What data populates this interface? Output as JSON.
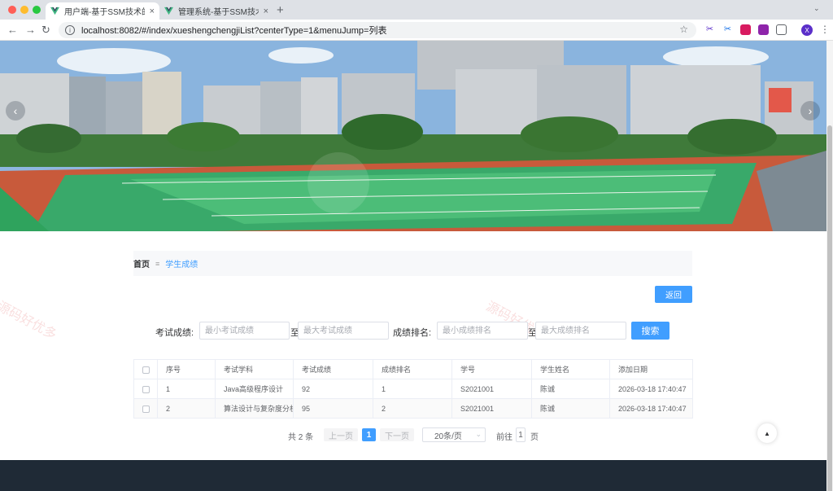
{
  "browser": {
    "tabs": [
      {
        "title": "用户端-基于SSM技术的高校选",
        "active": true
      },
      {
        "title": "管理系统-基于SSM技术的高校",
        "active": false
      }
    ],
    "url": "localhost:8082/#/index/xueshengchengjiList?centerType=1&menuJump=列表",
    "profile_initial": "X"
  },
  "watermark": "源码好优多",
  "breadcrumb": {
    "home": "首页",
    "separator": "≡",
    "current": "学生成绩"
  },
  "actions": {
    "back_label": "返回",
    "search_label": "搜索"
  },
  "search": {
    "score_label": "考试成绩:",
    "score_min_placeholder": "最小考试成绩",
    "score_max_placeholder": "最大考试成绩",
    "to_label": "至",
    "rank_label": "成绩排名:",
    "rank_min_placeholder": "最小成绩排名",
    "rank_max_placeholder": "最大成绩排名"
  },
  "table": {
    "columns": [
      "序号",
      "考试学科",
      "考试成绩",
      "成绩排名",
      "学号",
      "学生姓名",
      "添加日期"
    ],
    "rows": [
      [
        "1",
        "Java高级程序设计",
        "92",
        "1",
        "S2021001",
        "陈诚",
        "2026-03-18 17:40:47"
      ],
      [
        "2",
        "算法设计与复杂度分析",
        "95",
        "2",
        "S2021001",
        "陈诚",
        "2026-03-18 17:40:47"
      ]
    ]
  },
  "pagination": {
    "total": "共 2 条",
    "prev": "上一页",
    "current": "1",
    "next": "下一页",
    "page_size": "20条/页",
    "goto_label": "前往",
    "goto_value": "1",
    "goto_unit": "页"
  },
  "colors": {
    "primary": "#409eff",
    "footer": "#1f2a36"
  }
}
